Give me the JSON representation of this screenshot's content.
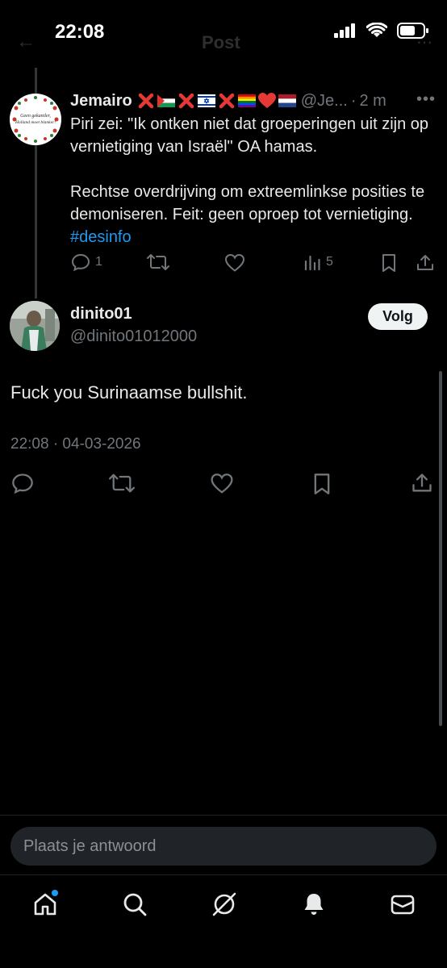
{
  "status_bar": {
    "time": "22:08"
  },
  "header": {
    "title": "Post"
  },
  "parent_tweet": {
    "display_name": "Jemairo",
    "handle": "@Je...",
    "separator": "·",
    "time_ago": "2 m",
    "avatar_lines": [
      "Geen gekantler,",
      "Holland moet blanker!"
    ],
    "text_p1": "Piri zei: \"Ik ontken niet dat groeperingen uit zijn op vernietiging van Israël\" OA hamas.",
    "text_p2": "Rechtse overdrijving om extreemlinkse posities te demoniseren. Feit: geen oproep tot vernietiging.",
    "hashtag": "#desinfo",
    "reply_count": "1",
    "view_count": "5"
  },
  "main_tweet": {
    "display_name": "dinito01",
    "handle": "@dinito01012000",
    "follow_label": "Volg",
    "text": "Fuck you Surinaamse bullshit.",
    "timestamp": "22:08 · 04-03-2026"
  },
  "reply": {
    "placeholder": "Plaats je antwoord"
  },
  "nav": {
    "items": [
      "home-icon",
      "search-icon",
      "grok-icon",
      "notifications-icon",
      "messages-icon"
    ]
  },
  "colors": {
    "background": "#000000",
    "text": "#e7e9ea",
    "muted": "#71767b",
    "accent": "#1d9bf0"
  }
}
